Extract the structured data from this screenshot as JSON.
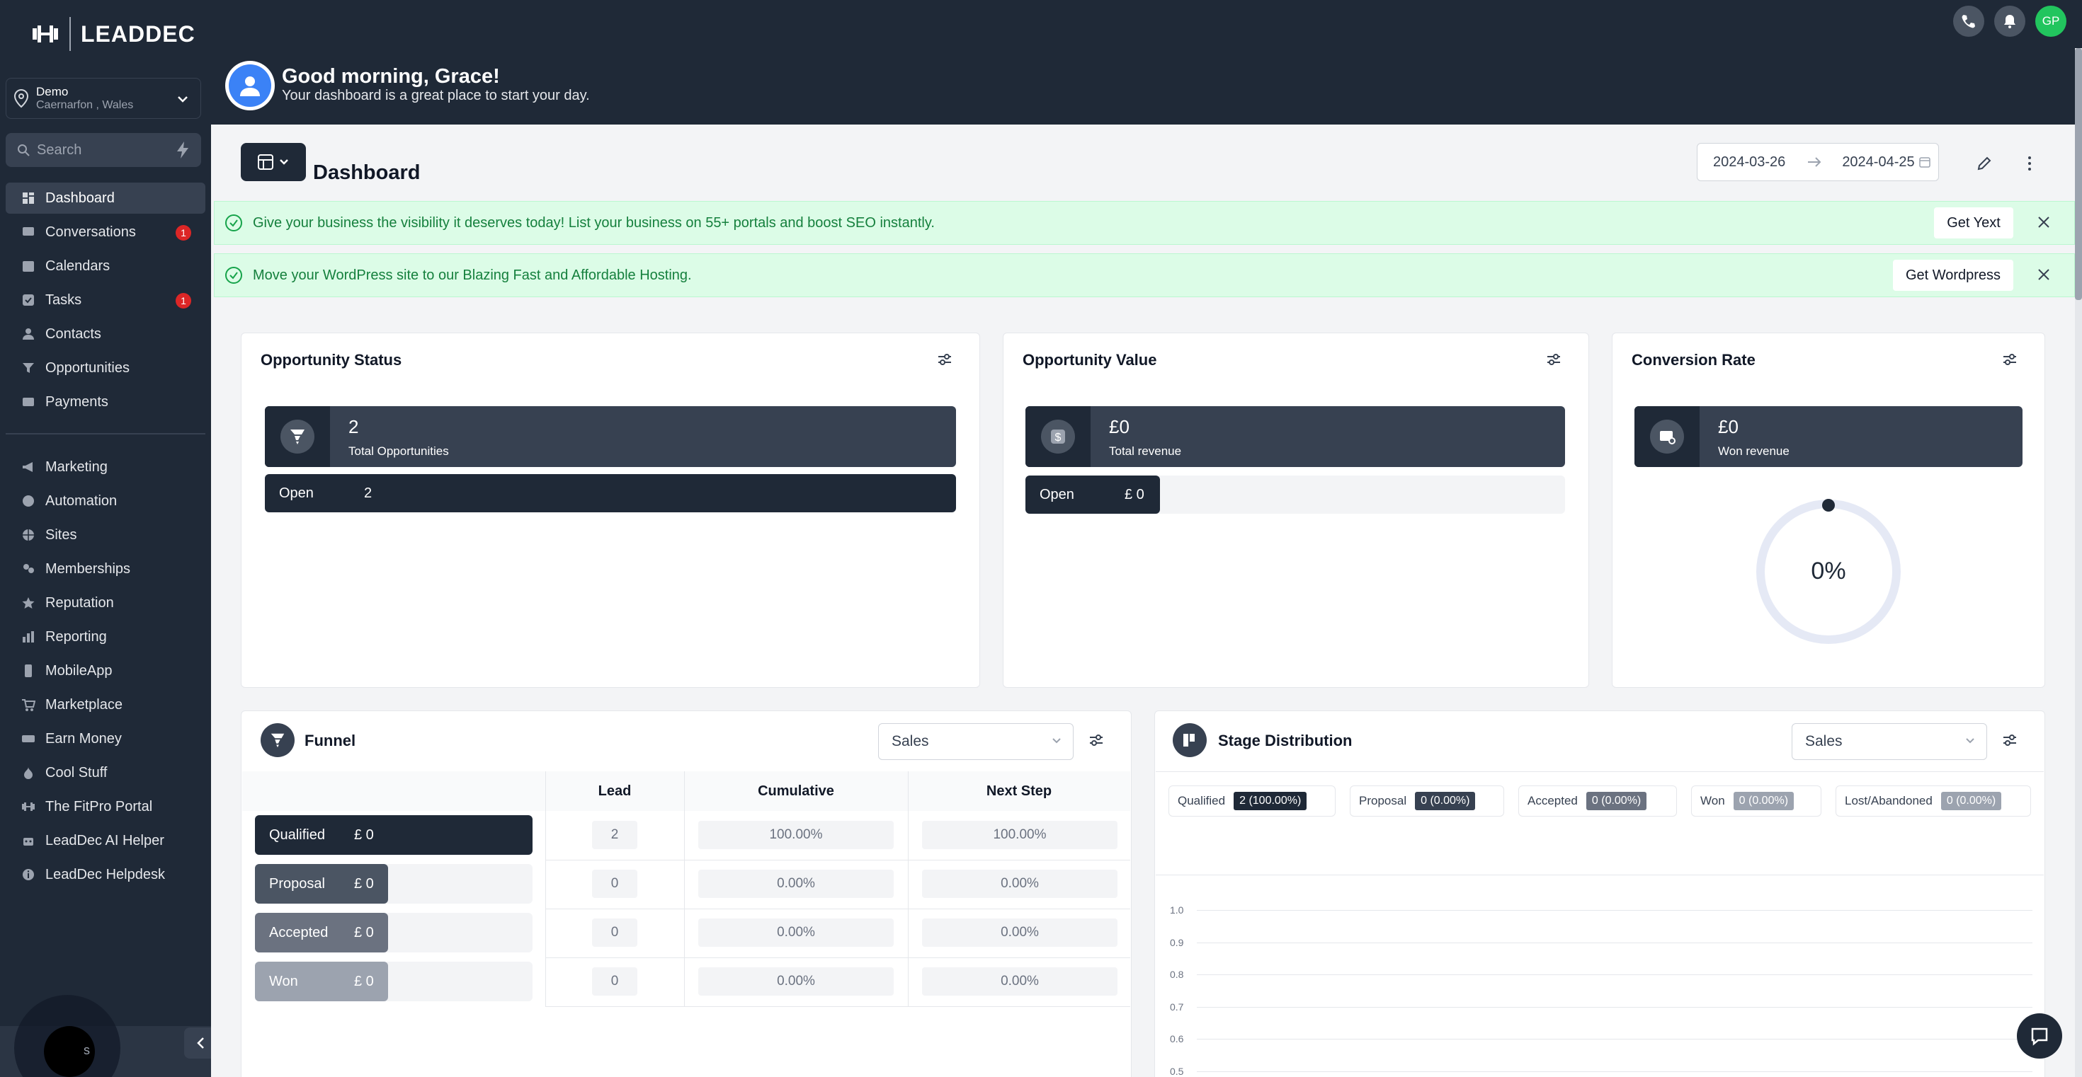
{
  "sidebar": {
    "logo_text": "LEADDEC",
    "location": {
      "name": "Demo",
      "sub": "Caernarfon , Wales"
    },
    "search_placeholder": "Search",
    "items": [
      {
        "label": "Dashboard",
        "icon": "dashboard-icon",
        "badge": ""
      },
      {
        "label": "Conversations",
        "icon": "chat-icon",
        "badge": "1"
      },
      {
        "label": "Calendars",
        "icon": "calendar-icon",
        "badge": ""
      },
      {
        "label": "Tasks",
        "icon": "check-icon",
        "badge": "1"
      },
      {
        "label": "Contacts",
        "icon": "person-icon",
        "badge": ""
      },
      {
        "label": "Opportunities",
        "icon": "funnel-icon",
        "badge": ""
      },
      {
        "label": "Payments",
        "icon": "card-icon",
        "badge": ""
      },
      {
        "label": "Marketing",
        "icon": "megaphone-icon",
        "badge": ""
      },
      {
        "label": "Automation",
        "icon": "automation-icon",
        "badge": ""
      },
      {
        "label": "Sites",
        "icon": "globe-icon",
        "badge": ""
      },
      {
        "label": "Memberships",
        "icon": "members-icon",
        "badge": ""
      },
      {
        "label": "Reputation",
        "icon": "star-icon",
        "badge": ""
      },
      {
        "label": "Reporting",
        "icon": "chart-icon",
        "badge": ""
      },
      {
        "label": "MobileApp",
        "icon": "phone-icon",
        "badge": ""
      },
      {
        "label": "Marketplace",
        "icon": "cart-icon",
        "badge": ""
      },
      {
        "label": "Earn Money",
        "icon": "money-icon",
        "badge": ""
      },
      {
        "label": "Cool Stuff",
        "icon": "flame-icon",
        "badge": ""
      },
      {
        "label": "The FitPro Portal",
        "icon": "dumbbell-icon",
        "badge": ""
      },
      {
        "label": "LeadDec AI Helper",
        "icon": "robot-icon",
        "badge": ""
      },
      {
        "label": "LeadDec Helpdesk",
        "icon": "info-icon",
        "badge": ""
      }
    ],
    "bottom_label": "s"
  },
  "topbar": {
    "avatar_initials": "GP"
  },
  "greeting": {
    "title": "Good morning, Grace!",
    "subtitle": "Your dashboard is a great place to start your day."
  },
  "dashboard": {
    "title": "Dashboard",
    "date_start": "2024-03-26",
    "date_end": "2024-04-25"
  },
  "banners": [
    {
      "text": "Give your business the visibility it deserves today! List your business on 55+ portals and boost SEO instantly.",
      "button": "Get Yext"
    },
    {
      "text": "Move your WordPress site to our Blazing Fast and Affordable Hosting.",
      "button": "Get Wordpress"
    }
  ],
  "opportunity_status": {
    "title": "Opportunity Status",
    "value": "2",
    "label": "Total Opportunities",
    "row_label": "Open",
    "row_value": "2"
  },
  "opportunity_value": {
    "title": "Opportunity Value",
    "value": "£0",
    "label": "Total revenue",
    "row_label": "Open",
    "row_value": "£ 0"
  },
  "conversion_rate": {
    "title": "Conversion Rate",
    "value": "£0",
    "label": "Won revenue",
    "percent": "0%"
  },
  "funnel": {
    "title": "Funnel",
    "select": "Sales",
    "headers": [
      "Lead",
      "Cumulative",
      "Next Step"
    ],
    "rows": [
      {
        "stage": "Qualified",
        "amount": "£ 0",
        "lead": "2",
        "cumulative": "100.00%",
        "next": "100.00%",
        "fill": 1.0,
        "color": "#1f2937"
      },
      {
        "stage": "Proposal",
        "amount": "£ 0",
        "lead": "0",
        "cumulative": "0.00%",
        "next": "0.00%",
        "fill": 0.48,
        "color": "#4b5563"
      },
      {
        "stage": "Accepted",
        "amount": "£ 0",
        "lead": "0",
        "cumulative": "0.00%",
        "next": "0.00%",
        "fill": 0.48,
        "color": "#6b7280"
      },
      {
        "stage": "Won",
        "amount": "£ 0",
        "lead": "0",
        "cumulative": "0.00%",
        "next": "0.00%",
        "fill": 0.48,
        "color": "#9ca3af"
      }
    ]
  },
  "stage_distribution": {
    "title": "Stage Distribution",
    "select": "Sales",
    "stages": [
      {
        "name": "Qualified",
        "value": "2 (100.00%)",
        "color": "#1f2937"
      },
      {
        "name": "Proposal",
        "value": "0 (0.00%)",
        "color": "#374151"
      },
      {
        "name": "Accepted",
        "value": "0 (0.00%)",
        "color": "#6b7280"
      },
      {
        "name": "Won",
        "value": "0 (0.00%)",
        "color": "#9ca3af"
      },
      {
        "name": "Lost/Abandoned",
        "value": "0 (0.00%)",
        "color": "#9ca3af"
      }
    ],
    "y_ticks": [
      "1.0",
      "0.9",
      "0.8",
      "0.7",
      "0.6",
      "0.5"
    ]
  }
}
